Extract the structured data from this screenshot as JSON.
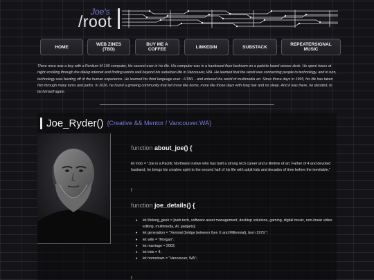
{
  "header": {
    "logo_small": "Joe's",
    "logo_big": "/root"
  },
  "nav": {
    "items": [
      {
        "label": "HOME"
      },
      {
        "label": "WEB ZINES (TBD)"
      },
      {
        "label": "BUY ME A COFFEE"
      },
      {
        "label": "LINKEDIN"
      },
      {
        "label": "SUBSTACK"
      },
      {
        "label": "REPEATERSIGNAL MUSIC"
      }
    ]
  },
  "intro": "There once was a boy with a Pentium M 100 computer, his second ever in his life. His computer was in a hardwood floor bedroom on a particle board veneer desk. He spent hours at night scrolling through the dialup internet and finding worlds well beyond his suburban life in Vancouver, WA. He learned that the world was connecting people to technology, and in turn, technology was feeding off of the human experience. He learned his third language ever - HTML - and entered the world of multimedia art. Since those days in 1995, his life has taken him through many turns and paths. In 2026, he found a growing community that felt more like home, more like those days with long hair and no sleep. And it was there, he decided, to be himself again.",
  "profile": {
    "name": "Joe_Ryder()",
    "subtitle": "{Creative && Mentor / Vancouver.WA}"
  },
  "about": {
    "keyword": "function",
    "name": "about_joe() {",
    "intro": "let intro = \"Joe is a Pacific Northwest native who has built a strong tech career and a lifetime of art. Father of 4 and devoted husband, he brings his creative spirit to the second half of his life with adult kids and decades of time before the inevitable.\"",
    "close": "}"
  },
  "details": {
    "keyword": "function",
    "name": "joe_details() {",
    "items": [
      "let lifelong_geek = [web tech, software asset management, desktop solutions, gaming, digital music, non-linear video editing, multimedia, AI, gadgets];",
      "let generation = \"Xennial (bridge between Gen X and Millennial), born 1979.\";",
      "let wife = \"Morgan\";",
      "let marriage = 2002;",
      "let kids = 4;",
      "let hometown = \"Vancouver, WA\";"
    ],
    "close": "}"
  }
}
